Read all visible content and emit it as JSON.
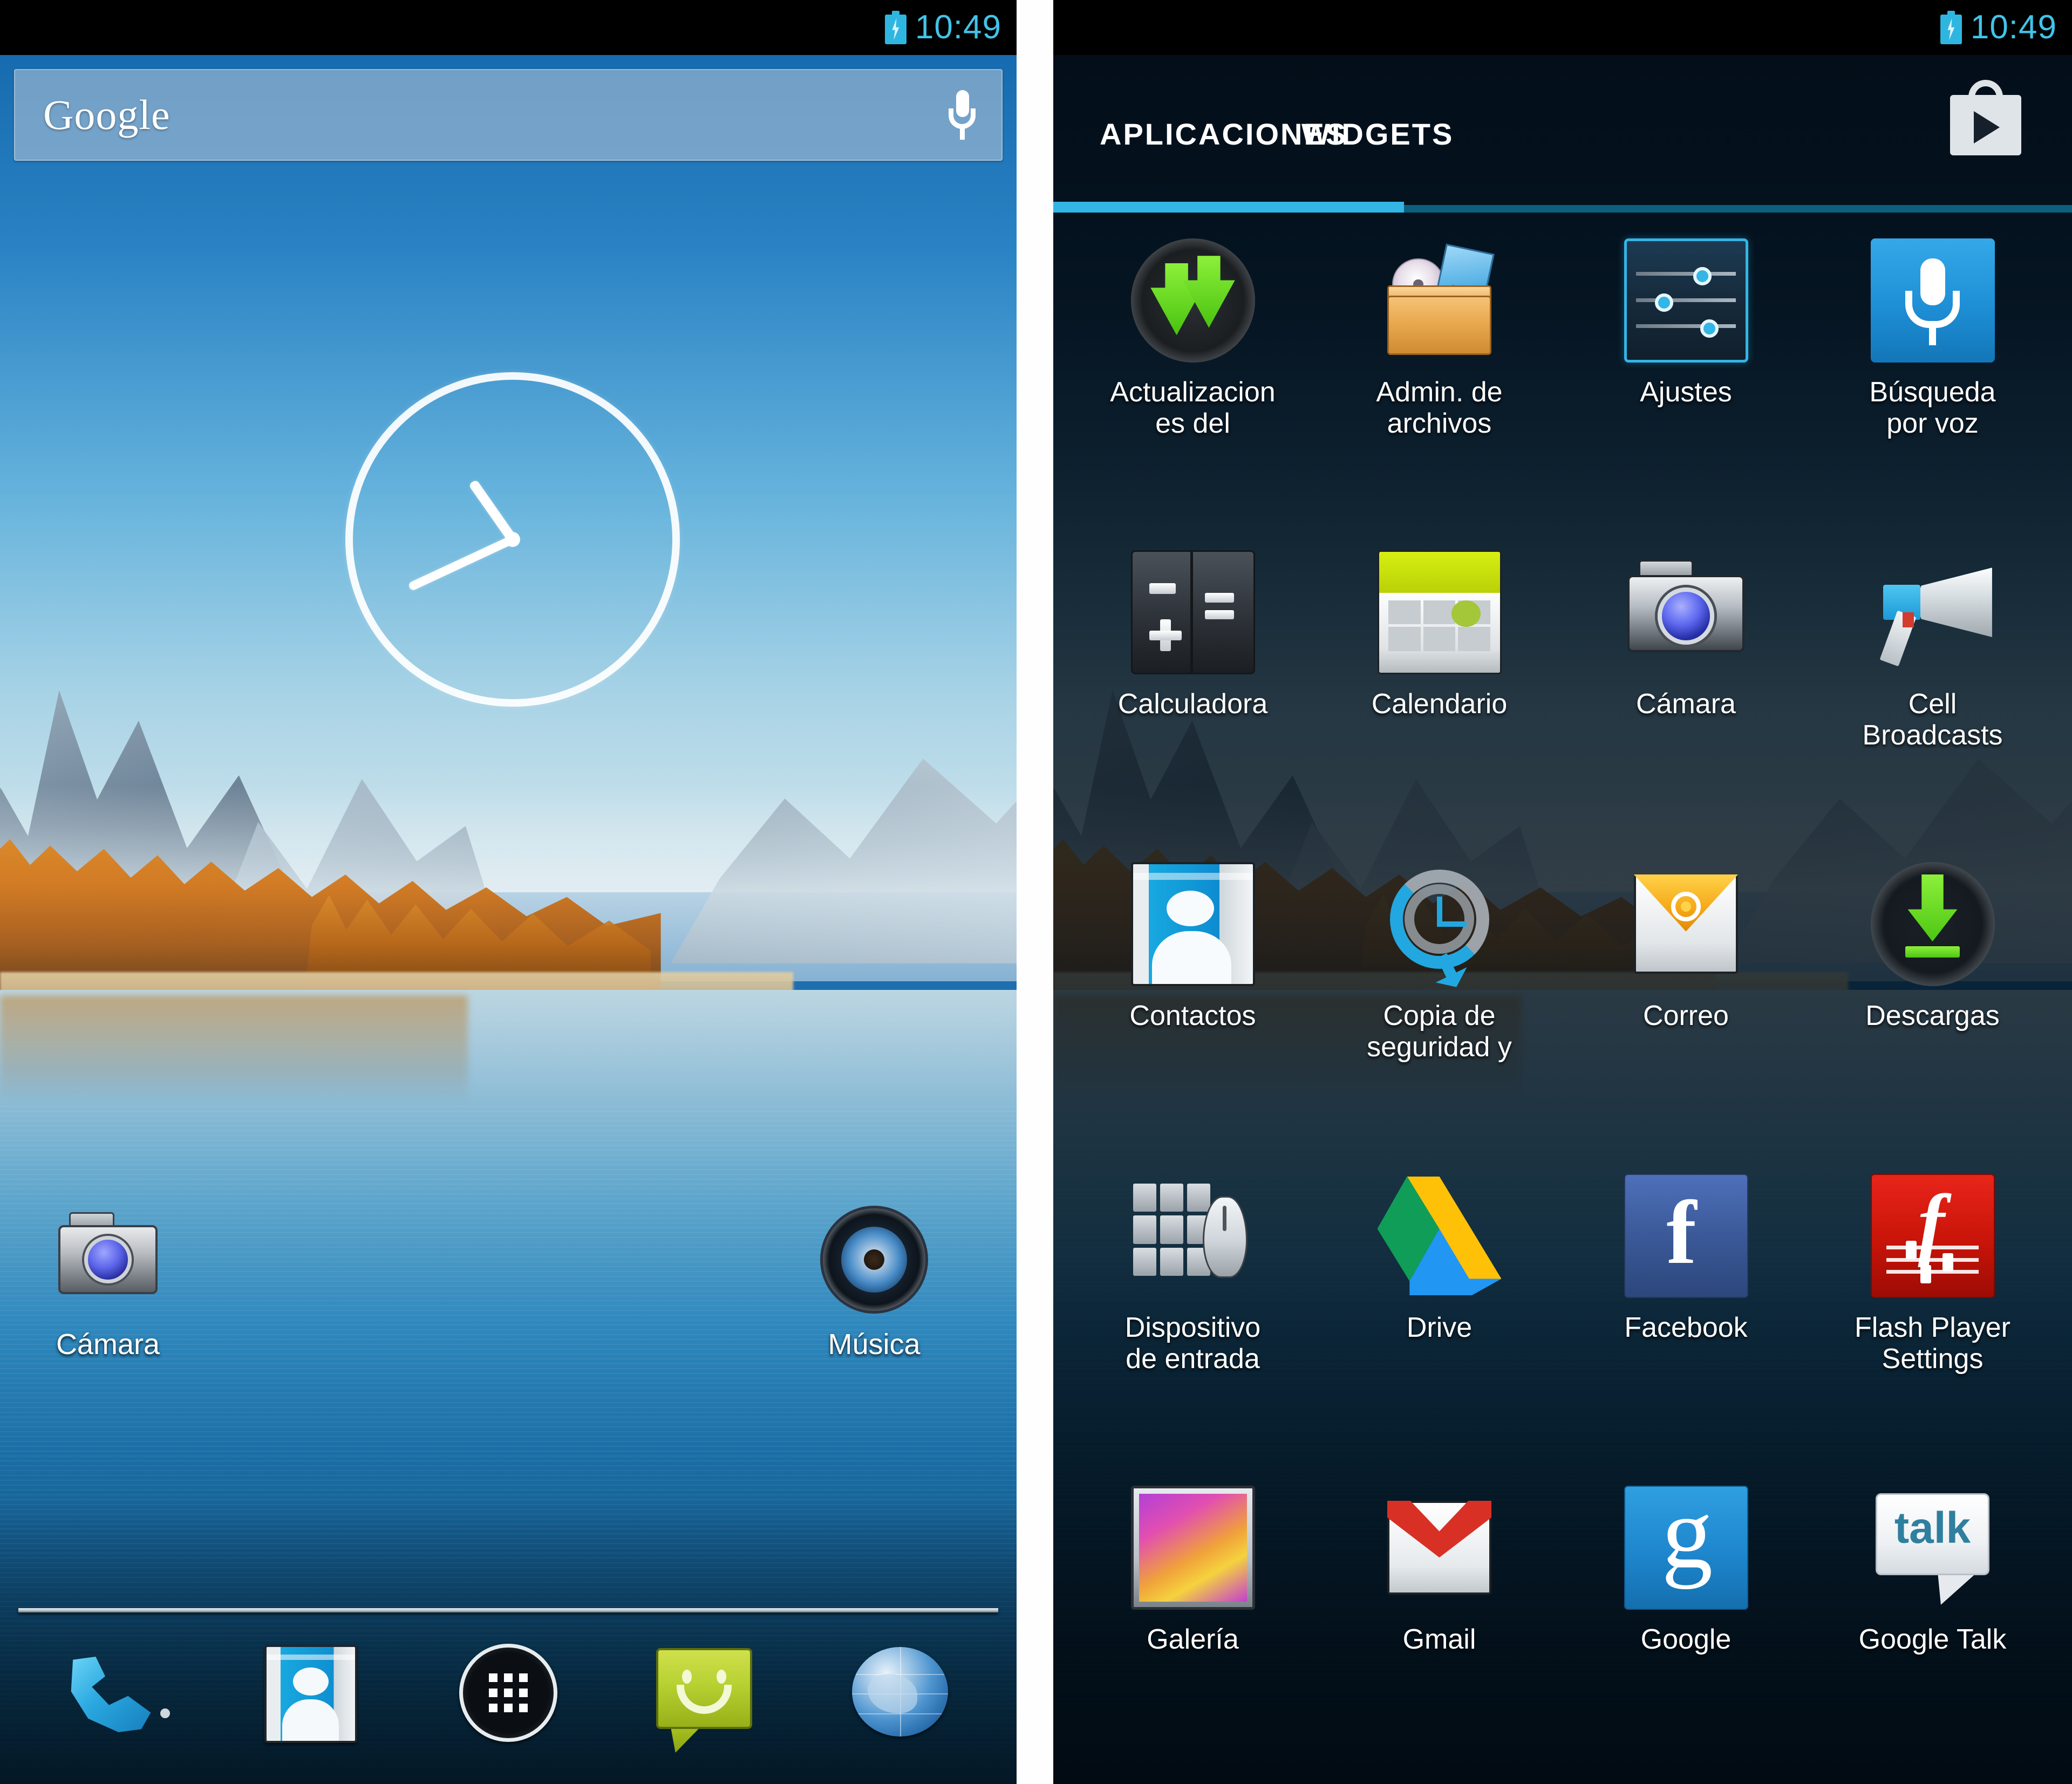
{
  "status_bar": {
    "time": "10:49",
    "battery_icon": "battery-charging-icon"
  },
  "home_screen": {
    "search": {
      "label": "Google",
      "mic_icon": "microphone-icon"
    },
    "clock_widget": {
      "name": "analog-clock-widget",
      "time": "10:49"
    },
    "shortcuts": [
      {
        "label": "Cámara",
        "icon": "camera-icon"
      },
      {
        "label": "Música",
        "icon": "music-speaker-icon"
      }
    ],
    "dock": [
      {
        "label": "Teléfono",
        "icon": "phone-icon"
      },
      {
        "label": "Contactos",
        "icon": "contacts-icon"
      },
      {
        "label": "Aplicaciones",
        "icon": "all-apps-grid-icon"
      },
      {
        "label": "Mensajes",
        "icon": "messaging-smiley-icon"
      },
      {
        "label": "Navegador",
        "icon": "browser-globe-icon"
      }
    ]
  },
  "app_drawer": {
    "tabs": [
      {
        "label": "APLICACIONES",
        "active": true
      },
      {
        "label": "WIDGETS",
        "active": false
      }
    ],
    "play_store_icon": "play-store-bag-icon",
    "accent_color": "#33b5e5",
    "apps": [
      {
        "label": "Actualizaciones del",
        "line1": "Actualizacion",
        "line2": "es del",
        "icon": "system-update-icon"
      },
      {
        "label": "Admin. de archivos",
        "line1": "Admin. de",
        "line2": "archivos",
        "icon": "file-manager-icon"
      },
      {
        "label": "Ajustes",
        "line1": "Ajustes",
        "line2": "",
        "icon": "settings-sliders-icon"
      },
      {
        "label": "Búsqueda por voz",
        "line1": "Búsqueda",
        "line2": "por voz",
        "icon": "voice-search-icon"
      },
      {
        "label": "Calculadora",
        "line1": "Calculadora",
        "line2": "",
        "icon": "calculator-icon"
      },
      {
        "label": "Calendario",
        "line1": "Calendario",
        "line2": "",
        "icon": "calendar-icon"
      },
      {
        "label": "Cámara",
        "line1": "Cámara",
        "line2": "",
        "icon": "camera-icon"
      },
      {
        "label": "Cell Broadcasts",
        "line1": "Cell",
        "line2": "Broadcasts",
        "icon": "cell-broadcast-megaphone-icon"
      },
      {
        "label": "Contactos",
        "line1": "Contactos",
        "line2": "",
        "icon": "contacts-icon"
      },
      {
        "label": "Copia de seguridad y",
        "line1": "Copia de",
        "line2": "seguridad y",
        "icon": "backup-restore-icon"
      },
      {
        "label": "Correo",
        "line1": "Correo",
        "line2": "",
        "icon": "email-envelope-icon"
      },
      {
        "label": "Descargas",
        "line1": "Descargas",
        "line2": "",
        "icon": "downloads-arrow-icon"
      },
      {
        "label": "Dispositivo de entrada",
        "line1": "Dispositivo",
        "line2": "de entrada",
        "icon": "input-device-icon"
      },
      {
        "label": "Drive",
        "line1": "Drive",
        "line2": "",
        "icon": "google-drive-icon"
      },
      {
        "label": "Facebook",
        "line1": "Facebook",
        "line2": "",
        "icon": "facebook-icon"
      },
      {
        "label": "Flash Player Settings",
        "line1": "Flash Player",
        "line2": "Settings",
        "icon": "flash-player-icon"
      },
      {
        "label": "Galería",
        "line1": "Galería",
        "line2": "",
        "icon": "gallery-icon"
      },
      {
        "label": "Gmail",
        "line1": "Gmail",
        "line2": "",
        "icon": "gmail-icon"
      },
      {
        "label": "Google",
        "line1": "Google",
        "line2": "",
        "icon": "google-search-icon"
      },
      {
        "label": "Google Talk",
        "line1": "Google Talk",
        "line2": "",
        "icon": "google-talk-icon"
      }
    ]
  }
}
